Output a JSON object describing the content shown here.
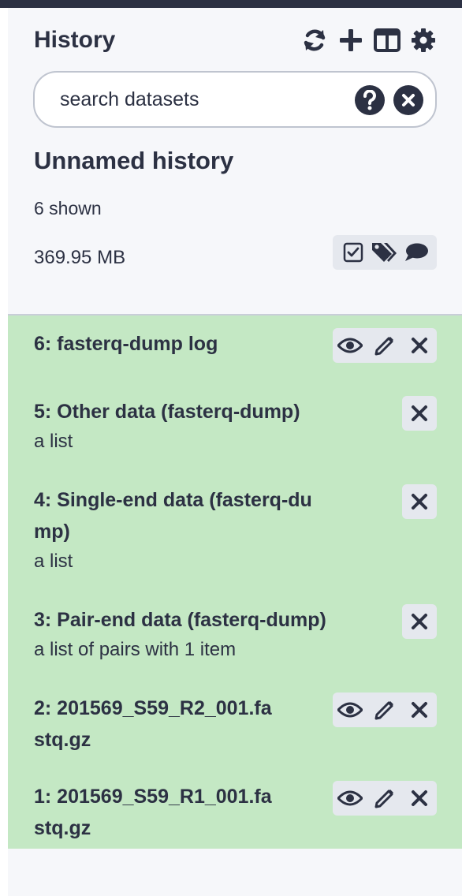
{
  "header": {
    "title": "History",
    "icons": [
      "sync-icon",
      "plus-icon",
      "columns-icon",
      "gear-icon"
    ]
  },
  "search": {
    "placeholder": "search datasets",
    "value": ""
  },
  "history": {
    "name": "Unnamed history",
    "shown": "6 shown",
    "size": "369.95 MB"
  },
  "items": [
    {
      "title": "6: fasterq-dump log",
      "subtitle": "",
      "actions": [
        "eye-icon",
        "pencil-icon",
        "close-icon"
      ]
    },
    {
      "title": "5: Other data (fasterq-dump)",
      "subtitle": "a list",
      "actions": [
        "close-icon"
      ]
    },
    {
      "title_line1": "4: Single-end data (fasterq-du",
      "title_line2": "mp)",
      "subtitle": "a list",
      "actions": [
        "close-icon"
      ]
    },
    {
      "title": "3: Pair-end data (fasterq-dump)",
      "subtitle": "a list of pairs with 1 item",
      "actions": [
        "close-icon"
      ]
    },
    {
      "title_line1": "2: 201569_S59_R2_001.fa",
      "title_line2": "stq.gz",
      "subtitle": "",
      "actions": [
        "eye-icon",
        "pencil-icon",
        "close-icon"
      ]
    },
    {
      "title_line1": "1: 201569_S59_R1_001.fa",
      "title_line2": "stq.gz",
      "subtitle": "",
      "actions": [
        "eye-icon",
        "pencil-icon",
        "close-icon"
      ]
    }
  ],
  "colors": {
    "text": "#2c3143",
    "panel": "#f6f7fa",
    "ok_state": "#c4e8c4",
    "button_bg": "#e5e8ee",
    "topbar": "#2c3143"
  }
}
